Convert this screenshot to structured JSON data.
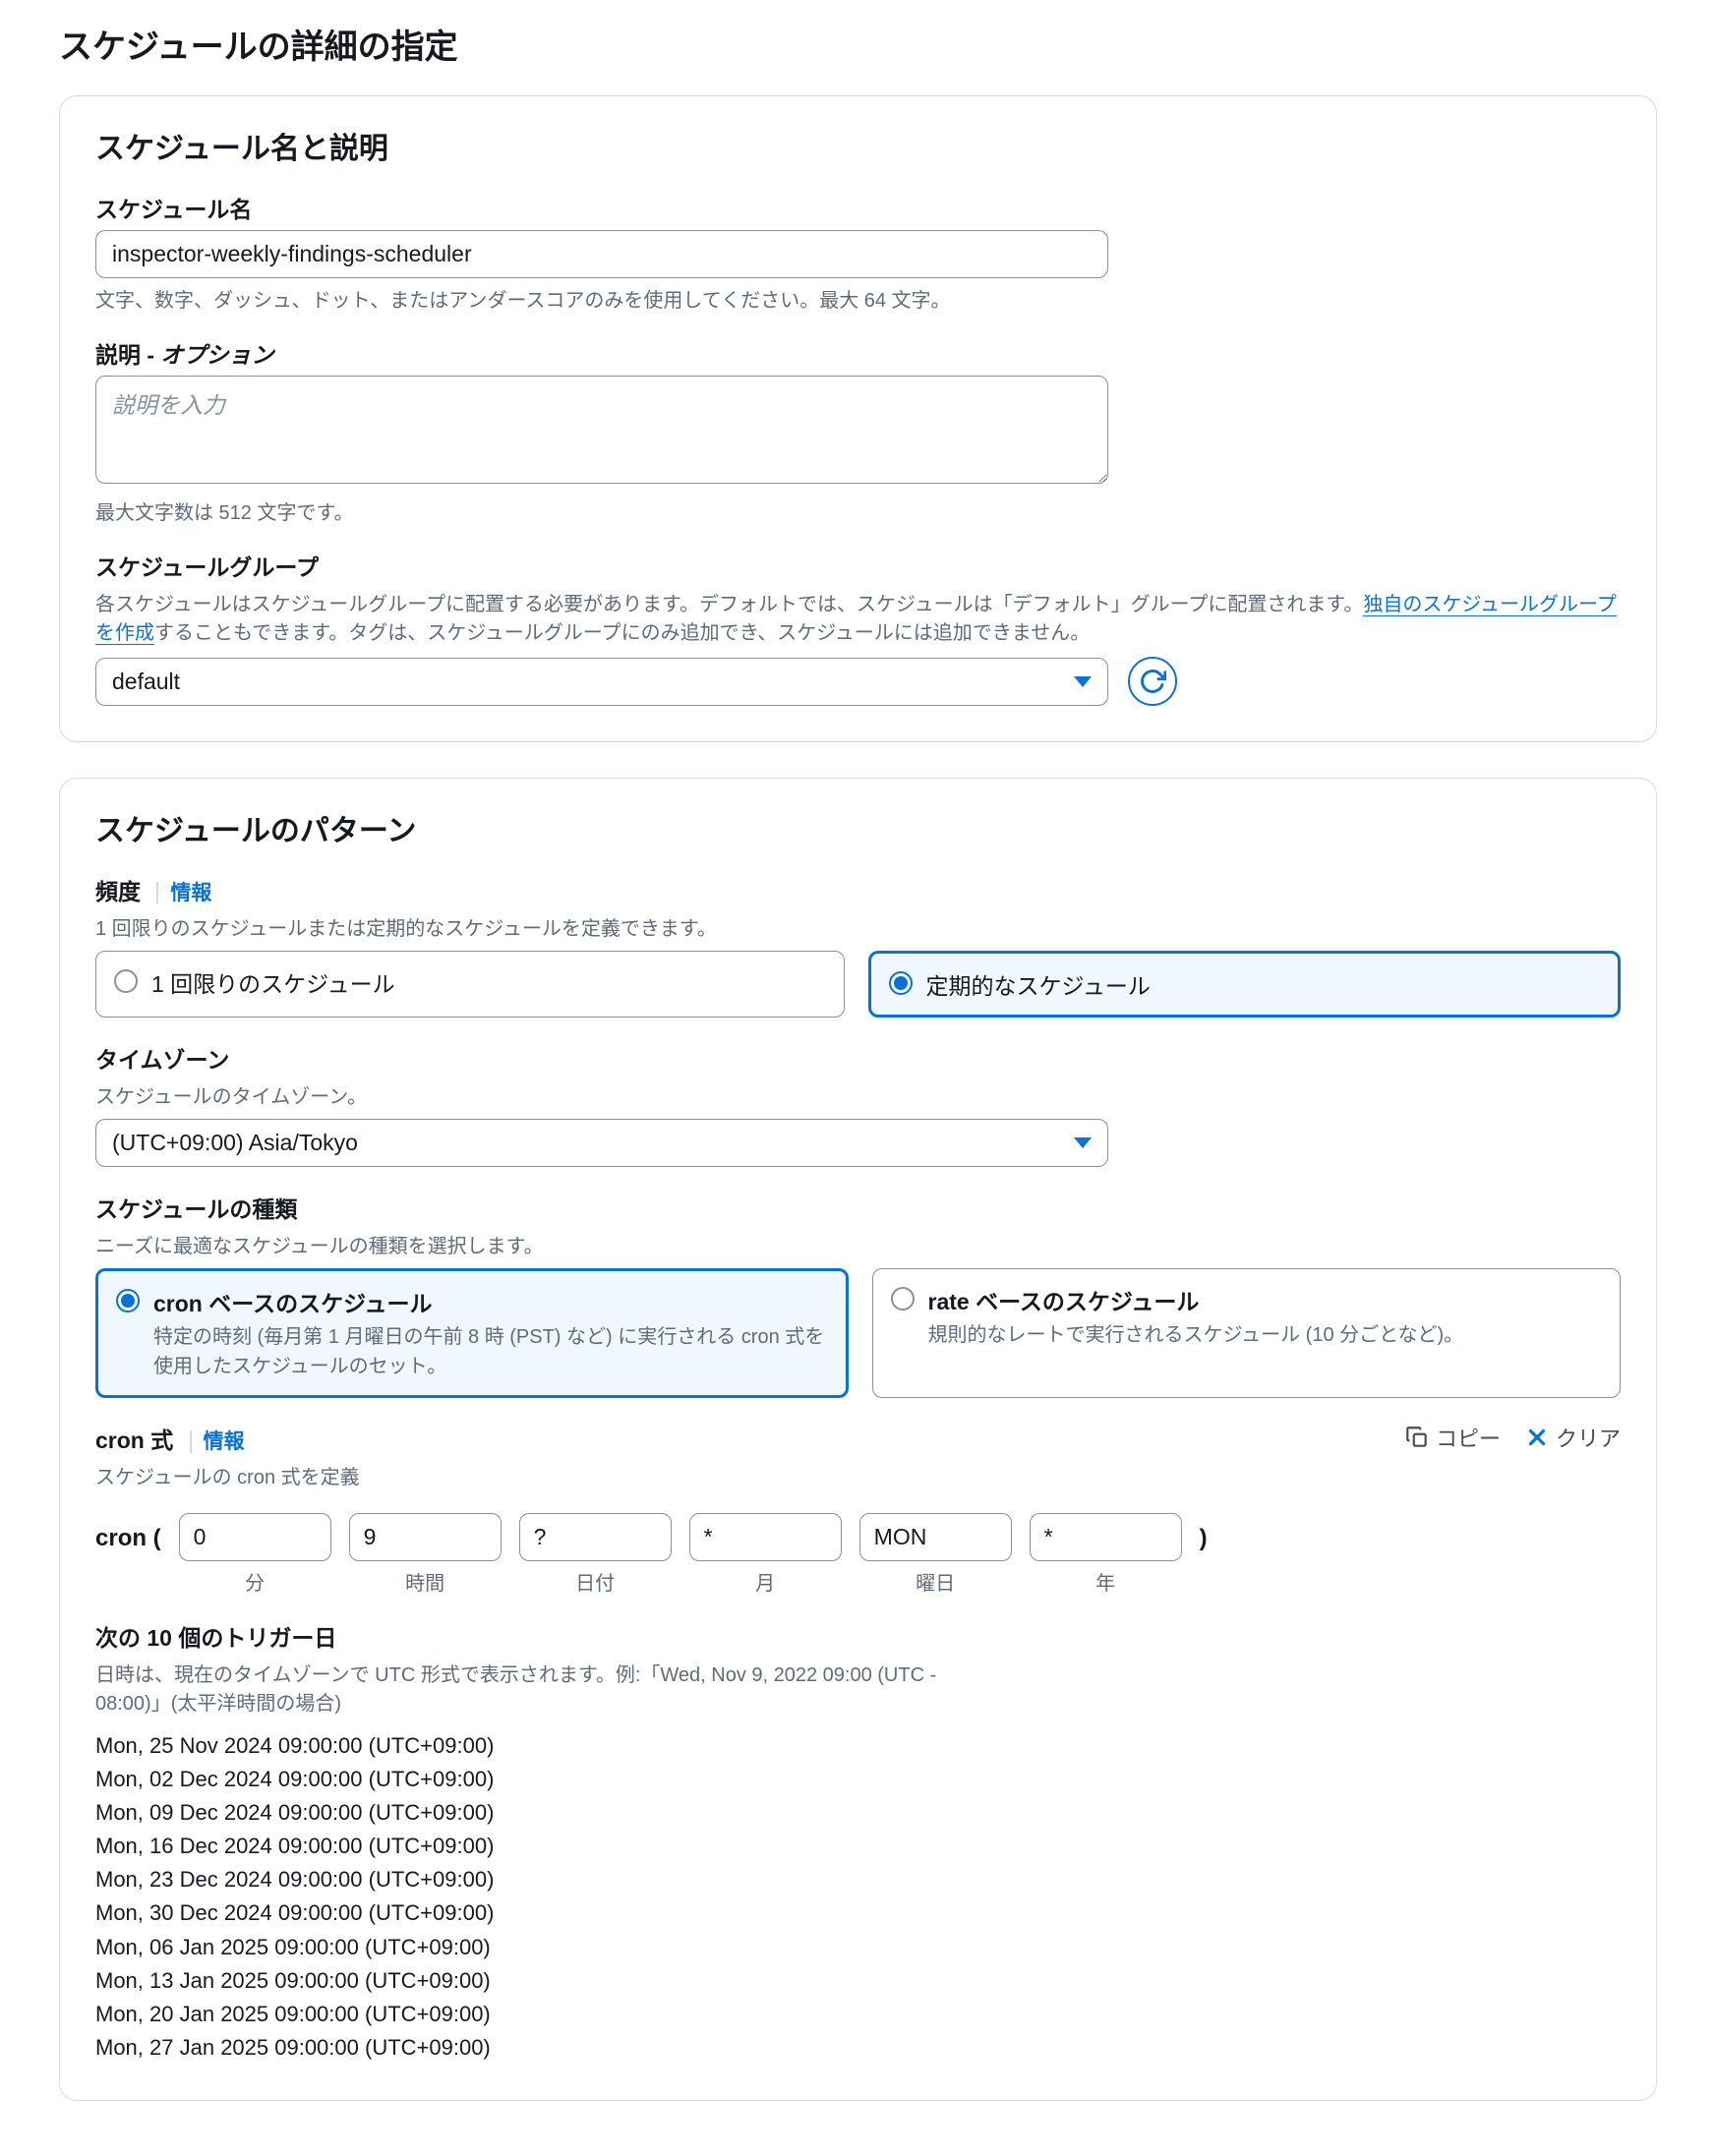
{
  "pageTitle": "スケジュールの詳細の指定",
  "nameSection": {
    "title": "スケジュール名と説明",
    "nameLabel": "スケジュール名",
    "nameValue": "inspector-weekly-findings-scheduler",
    "nameHelp": "文字、数字、ダッシュ、ドット、またはアンダースコアのみを使用してください。最大 64 文字。",
    "descLabel": "説明",
    "descOptional": " - オプション",
    "descPlaceholder": "説明を入力",
    "descHelp": "最大文字数は 512 文字です。",
    "groupLabel": "スケジュールグループ",
    "groupDescPrefix": "各スケジュールはスケジュールグループに配置する必要があります。デフォルトでは、スケジュールは「デフォルト」グループに配置されます。",
    "groupLink": "独自のスケジュールグループを作成",
    "groupDescSuffix": "することもできます。タグは、スケジュールグループにのみ追加でき、スケジュールには追加できません。",
    "groupSelected": "default"
  },
  "patternSection": {
    "title": "スケジュールのパターン",
    "freqLabel": "頻度",
    "info": "情報",
    "freqDesc": "1 回限りのスケジュールまたは定期的なスケジュールを定義できます。",
    "freqOptions": {
      "onetime": "1 回限りのスケジュール",
      "recurring": "定期的なスケジュール"
    },
    "tzLabel": "タイムゾーン",
    "tzDesc": "スケジュールのタイムゾーン。",
    "tzSelected": "(UTC+09:00) Asia/Tokyo",
    "typeLabel": "スケジュールの種類",
    "typeDesc": "ニーズに最適なスケジュールの種類を選択します。",
    "typeOptions": {
      "cronTitle": "cron ベースのスケジュール",
      "cronSub": "特定の時刻 (毎月第 1 月曜日の午前 8 時 (PST) など) に実行される cron 式を使用したスケジュールのセット。",
      "rateTitle": "rate ベースのスケジュール",
      "rateSub": "規則的なレートで実行されるスケジュール (10 分ごとなど)。"
    },
    "cronLabel": "cron 式",
    "cronDesc": "スケジュールの cron 式を定義",
    "copyAction": "コピー",
    "clearAction": "クリア",
    "cronOpen": "cron (",
    "cronClose": ")",
    "cronFields": {
      "minute": {
        "value": "0",
        "label": "分"
      },
      "hour": {
        "value": "9",
        "label": "時間"
      },
      "dayOfMonth": {
        "value": "?",
        "label": "日付"
      },
      "month": {
        "value": "*",
        "label": "月"
      },
      "dayOfWeek": {
        "value": "MON",
        "label": "曜日"
      },
      "year": {
        "value": "*",
        "label": "年"
      }
    },
    "triggersLabel": "次の 10 個のトリガー日",
    "triggersDesc": "日時は、現在のタイムゾーンで UTC 形式で表示されます。例:「Wed, Nov 9, 2022 09:00 (UTC - 08:00)」(太平洋時間の場合)",
    "triggers": [
      "Mon, 25 Nov 2024 09:00:00 (UTC+09:00)",
      "Mon, 02 Dec 2024 09:00:00 (UTC+09:00)",
      "Mon, 09 Dec 2024 09:00:00 (UTC+09:00)",
      "Mon, 16 Dec 2024 09:00:00 (UTC+09:00)",
      "Mon, 23 Dec 2024 09:00:00 (UTC+09:00)",
      "Mon, 30 Dec 2024 09:00:00 (UTC+09:00)",
      "Mon, 06 Jan 2025 09:00:00 (UTC+09:00)",
      "Mon, 13 Jan 2025 09:00:00 (UTC+09:00)",
      "Mon, 20 Jan 2025 09:00:00 (UTC+09:00)",
      "Mon, 27 Jan 2025 09:00:00 (UTC+09:00)"
    ]
  }
}
